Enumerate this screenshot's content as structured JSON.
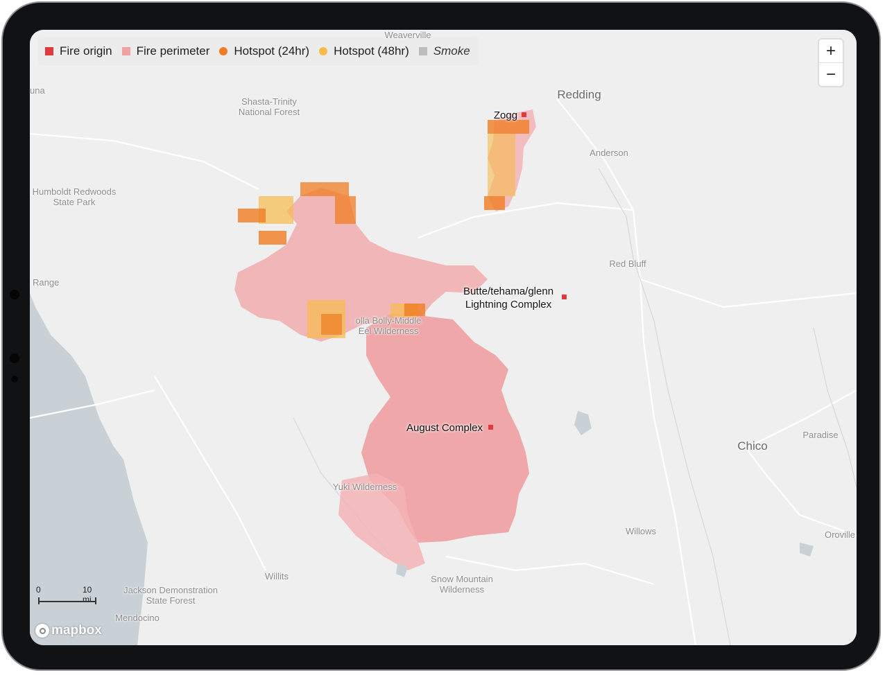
{
  "legend": {
    "items": [
      {
        "label": "Fire origin",
        "color": "#e03a3e",
        "shape": "square"
      },
      {
        "label": "Fire perimeter",
        "color": "#f1a1a3",
        "shape": "square"
      },
      {
        "label": "Hotspot (24hr)",
        "color": "#f07d23",
        "shape": "dot"
      },
      {
        "label": "Hotspot (48hr)",
        "color": "#f6bb4c",
        "shape": "dot"
      },
      {
        "label": "Smoke",
        "color": "#bdbdbd",
        "shape": "square",
        "italic": true
      }
    ]
  },
  "zoom": {
    "in_label": "+",
    "out_label": "−"
  },
  "places": {
    "weaverville": "Weaverville",
    "redding": "Redding",
    "shasta_trinity": "Shasta-Trinity\nNational Forest",
    "anderson": "Anderson",
    "humboldt": "Humboldt Redwoods\nState Park",
    "una": "una",
    "range": "Range",
    "red_bluff": "Red Bluff",
    "yolla_bolly": "olla Bolly-Middle\nEel Wilderness",
    "chico": "Chico",
    "paradise": "Paradise",
    "yuki": "Yuki Wilderness",
    "willows": "Willows",
    "oroville": "Oroville",
    "willits": "Willits",
    "snow_mountain": "Snow Mountain\nWilderness",
    "jackson": "Jackson Demonstration\nState Forest",
    "mendocino": "Mendocino"
  },
  "fires": [
    {
      "name": "Zogg"
    },
    {
      "name": "Butte/tehama/glenn\nLightning Complex"
    },
    {
      "name": "August Complex"
    }
  ],
  "scale": {
    "start": "0",
    "end": "10 mi"
  },
  "attribution": "mapbox",
  "colors": {
    "ocean": "#c9d1d6",
    "land": "#efefef",
    "perimeter": "#f1a1a3",
    "perimeter_dark": "#ee9a9c",
    "origin": "#e03a3e",
    "hotspot24": "#f07d23",
    "hotspot48": "#f6bb4c"
  }
}
